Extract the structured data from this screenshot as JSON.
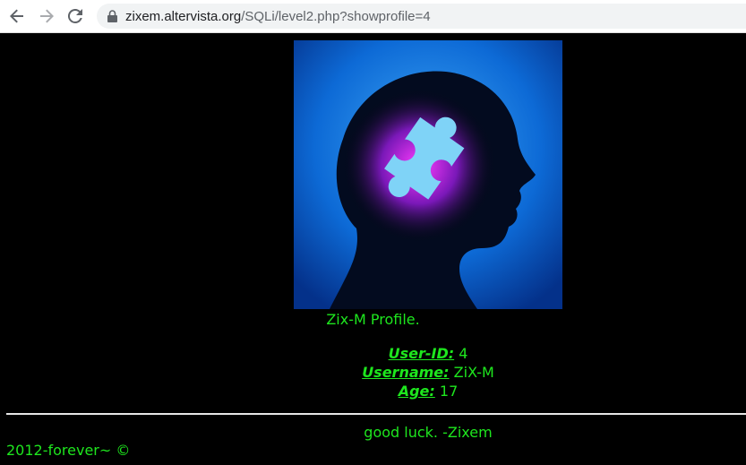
{
  "browser": {
    "url_host": "zixem.altervista.org",
    "url_path": "/SQLi/level2.php?showprofile=4",
    "icons": [
      "back-arrow-icon",
      "forward-arrow-icon",
      "reload-icon",
      "lock-icon"
    ]
  },
  "page": {
    "profile_title": "Zix-M Profile.",
    "fields": [
      {
        "label": "User-ID:",
        "value": "4"
      },
      {
        "label": "Username:",
        "value": "ZiX-M"
      },
      {
        "label": "Age:",
        "value": "17"
      }
    ],
    "footer_message": "good luck. -Zixem",
    "copyright": "2012-forever~ ©",
    "colors": {
      "background": "#000000",
      "text": "#1ee61e",
      "image_blue": "#0a63c9",
      "puzzle": "#7fd3f7"
    }
  }
}
